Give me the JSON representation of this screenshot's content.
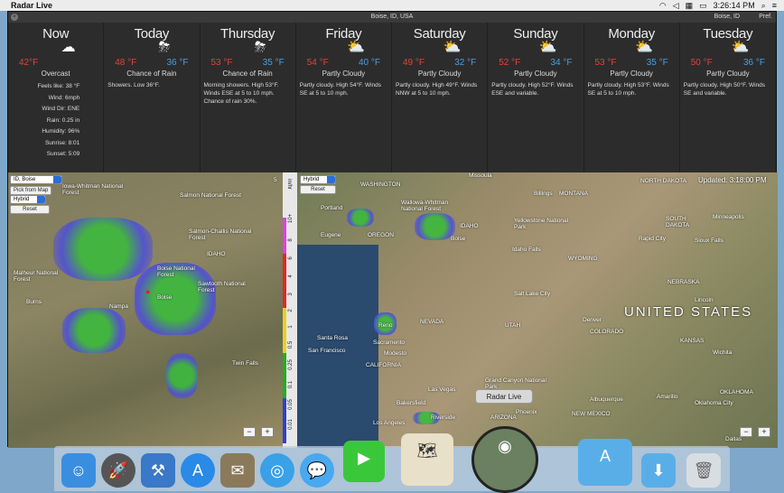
{
  "menubar": {
    "app_name": "Radar Live",
    "clock": "3:26:14 PM"
  },
  "window": {
    "location": "Boise, ID, USA",
    "location_right": "Boise, ID",
    "pref": "Pref."
  },
  "now": {
    "name": "Now",
    "temp": "42°F",
    "condition": "Overcast",
    "details": [
      "Feels like: 38 °F",
      "Wind: 6mph",
      "Wind Dir: ENE",
      "Rain: 0.25 in",
      "Humidity: 96%",
      "Sunrise: 8:01",
      "Sunset: 5:09"
    ]
  },
  "days": [
    {
      "name": "Today",
      "hi": "48 °F",
      "lo": "36 °F",
      "cond": "Chance of Rain",
      "desc": "Showers. Low 36°F."
    },
    {
      "name": "Thursday",
      "hi": "53 °F",
      "lo": "35 °F",
      "cond": "Chance of Rain",
      "desc": "Morning showers. High 53°F. Winds ESE at 5 to 10 mph. Chance of rain 30%."
    },
    {
      "name": "Friday",
      "hi": "54 °F",
      "lo": "40 °F",
      "cond": "Partly Cloudy",
      "desc": "Partly cloudy. High 54°F. Winds SE at 5 to 10 mph."
    },
    {
      "name": "Saturday",
      "hi": "49 °F",
      "lo": "32 °F",
      "cond": "Partly Cloudy",
      "desc": "Partly cloudy. High 49°F. Winds NNW at 5 to 10 mph."
    },
    {
      "name": "Sunday",
      "hi": "52 °F",
      "lo": "34 °F",
      "cond": "Partly Cloudy",
      "desc": "Partly cloudy. High 52°F. Winds ESE and variable."
    },
    {
      "name": "Monday",
      "hi": "53 °F",
      "lo": "35 °F",
      "cond": "Partly Cloudy",
      "desc": "Partly cloudy. High 53°F. Winds SE at 5 to 10 mph."
    },
    {
      "name": "Tuesday",
      "hi": "50 °F",
      "lo": "36 °F",
      "cond": "Partly Cloudy",
      "desc": "Partly cloudy. High 50°F. Winds SE and variable."
    }
  ],
  "left_map": {
    "location_select": "ID, Boise",
    "pick_button": "Pick from Map",
    "type_select": "Hybrid",
    "reset_button": "Reset",
    "scale_number": "5",
    "labels": [
      "Iowa-Whitman National Forest",
      "Salmon National Forest",
      "Salmon-Challis National Forest",
      "IDAHO",
      "Boise National Forest",
      "Sawtooth National Forest",
      "Malheur National Forest",
      "Burns",
      "Nampa",
      "Boise",
      "Twin Falls"
    ]
  },
  "scale": {
    "unit": "in/hr",
    "ticks": [
      "10+",
      "8",
      "6",
      "4",
      "3",
      "2",
      "1",
      "0.5",
      "0.25",
      "0.1",
      "0.05",
      "0.01"
    ]
  },
  "right_map": {
    "type_select": "Hybrid",
    "reset_button": "Reset",
    "updated": "Updated: 3:18:00 PM",
    "labels": [
      "WASHINGTON",
      "MONTANA",
      "NORTH DAKOTA",
      "Missoula",
      "Billings",
      "Portland",
      "Wallowa-Whitman National Forest",
      "IDAHO",
      "OREGON",
      "Eugene",
      "Boise",
      "Yellowstone National Park",
      "Idaho Falls",
      "SOUTH DAKOTA",
      "Minneapolis",
      "Rapid City",
      "Sioux Falls",
      "WYOMING",
      "Salt Lake City",
      "NEBRASKA",
      "Lincoln",
      "Reno",
      "NEVADA",
      "UTAH",
      "Denver",
      "COLORADO",
      "UNITED STATES",
      "KANSAS",
      "Wichita",
      "Santa Rosa",
      "Sacramento",
      "San Francisco",
      "Modesto",
      "CALIFORNIA",
      "Las Vegas",
      "Grand Canyon National Park",
      "OKLAHOMA",
      "Oklahoma City",
      "Amarillo",
      "Albuquerque",
      "NEW MEXICO",
      "Bakersfield",
      "Los Angeles",
      "Riverside",
      "Phoenix",
      "ARIZONA",
      "Dallas"
    ]
  },
  "tooltip": "Radar Live",
  "zoom": {
    "minus": "−",
    "plus": "+"
  }
}
